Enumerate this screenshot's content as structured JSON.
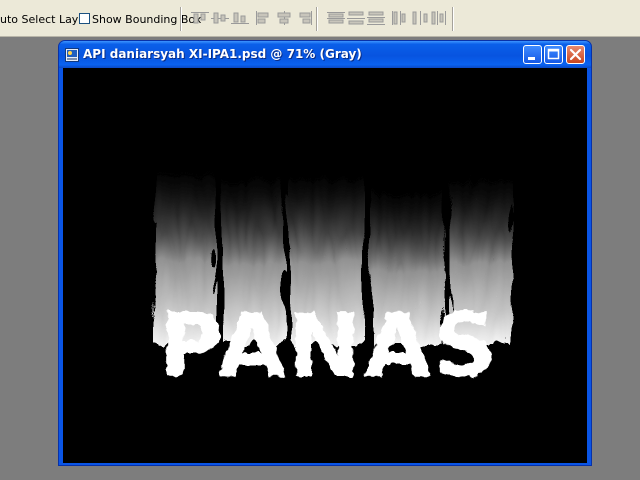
{
  "options_bar": {
    "auto_select_label": "uto Select Layer",
    "show_bounding_label": "Show Bounding Box",
    "show_bounding_checked": false,
    "align_icons": [
      "align-top-icon",
      "align-vcenter-icon",
      "align-bottom-icon",
      "align-left-icon",
      "align-hcenter-icon",
      "align-right-icon"
    ],
    "distribute_icons": [
      "distribute-top-icon",
      "distribute-vcenter-icon",
      "distribute-bottom-icon",
      "distribute-left-icon",
      "distribute-hcenter-icon",
      "distribute-right-icon"
    ]
  },
  "document": {
    "title": "API daniarsyah XI-IPA1.psd @ 71% (Gray)",
    "canvas_text": "PANAS",
    "canvas_background": "#000000",
    "text_color": "#ffffff"
  },
  "colors": {
    "titlebar": "#0754e0",
    "close_button": "#c9461f",
    "workspace": "#7d7d7d",
    "toolbar": "#ece9d8"
  }
}
